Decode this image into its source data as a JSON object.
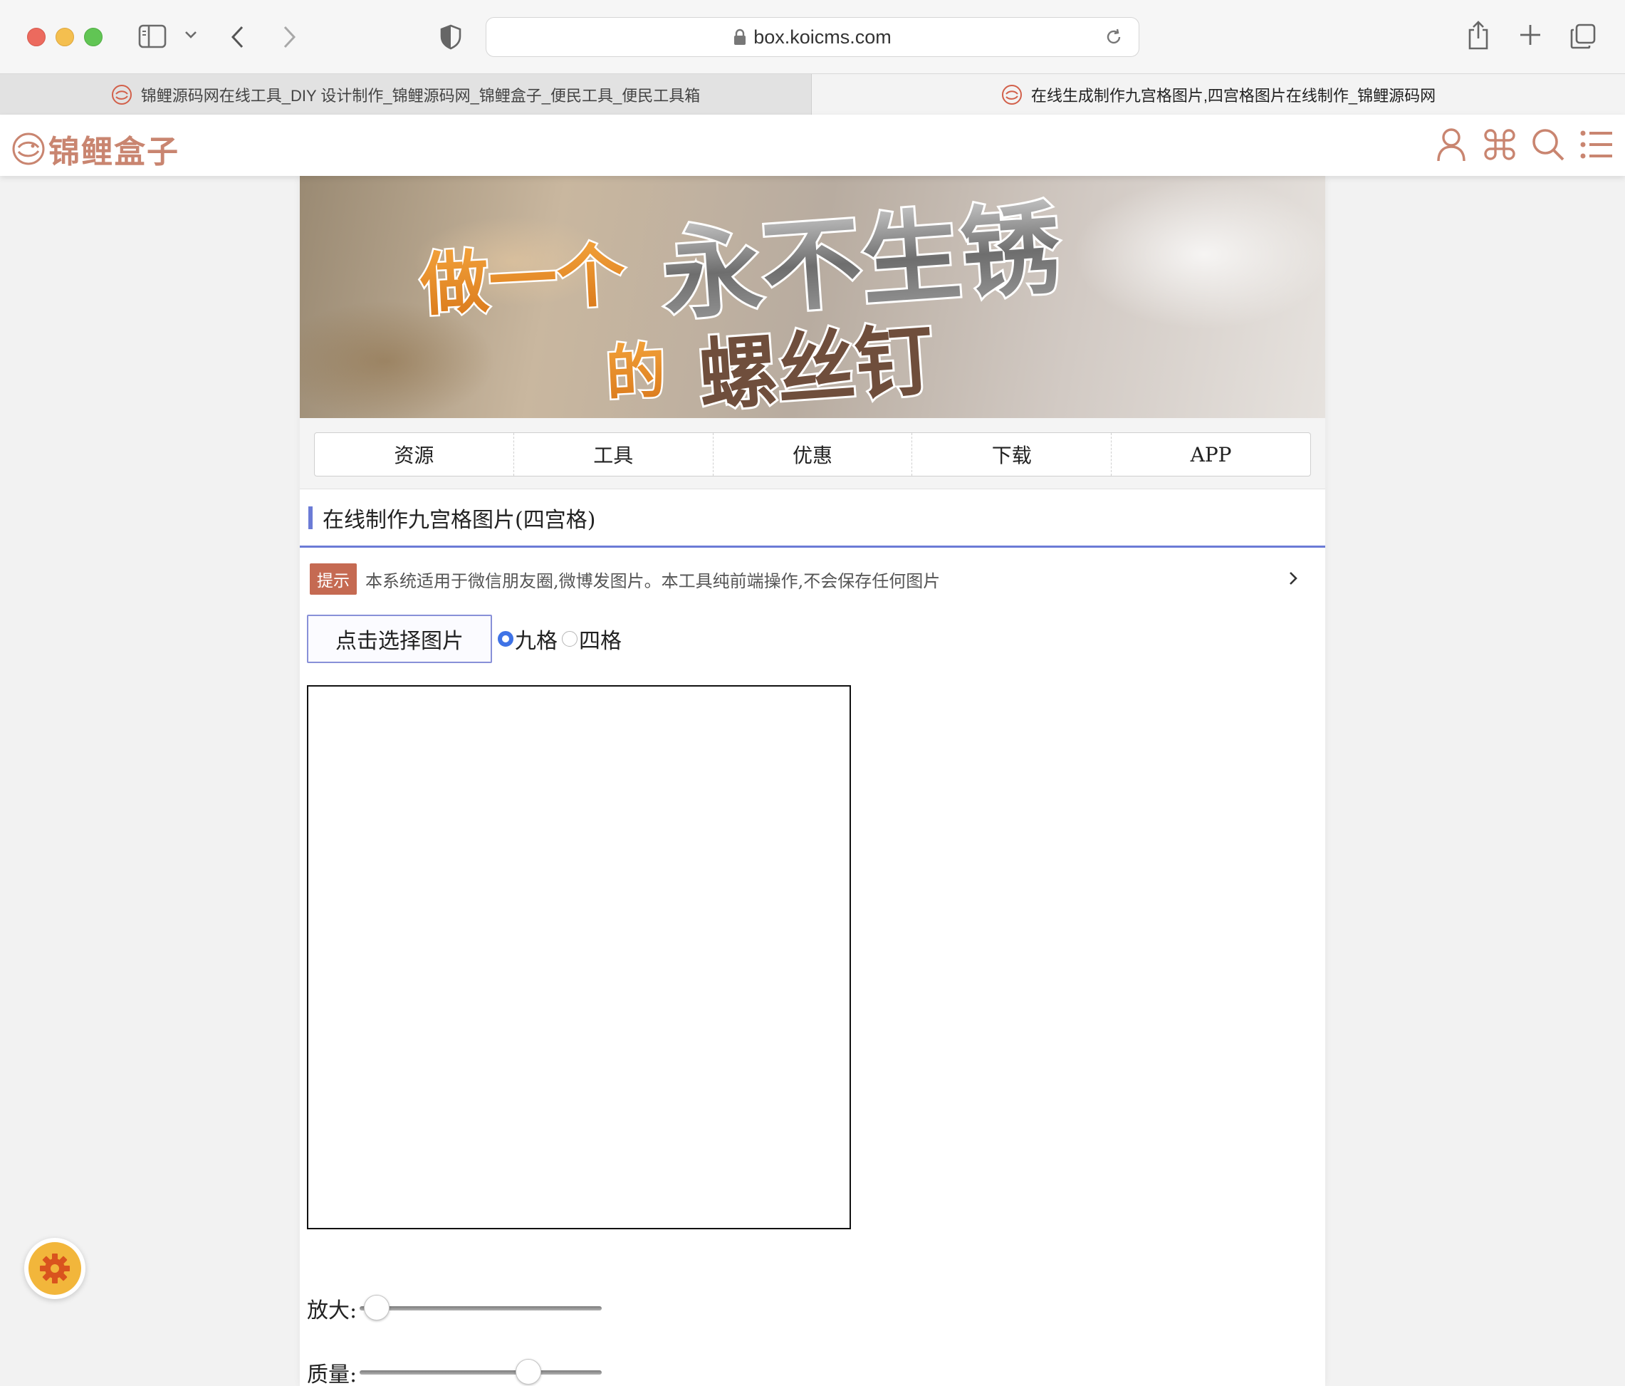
{
  "browser": {
    "url": "box.koicms.com",
    "tabs": [
      {
        "label": "锦鲤源码网在线工具_DIY 设计制作_锦鲤源码网_锦鲤盒子_便民工具_便民工具箱",
        "active": false
      },
      {
        "label": "在线生成制作九宫格图片,四宫格图片在线制作_锦鲤源码网",
        "active": true
      }
    ]
  },
  "site": {
    "logo_text": "锦鲤盒子",
    "brand_color": "#c98570",
    "header_icons": [
      "user-icon",
      "apps-icon",
      "search-icon",
      "menu-list-icon"
    ]
  },
  "banner": {
    "line1_orange": "做一个",
    "line1_steel": "永不生锈",
    "line2_orange": "的",
    "line2_brown": "螺丝钉"
  },
  "nav": {
    "items": [
      "资源",
      "工具",
      "优惠",
      "下载",
      "APP"
    ]
  },
  "section": {
    "title": "在线制作九宫格图片(四宫格)",
    "accent_color": "#6b7bd6"
  },
  "notice": {
    "tag": "提示",
    "text": "本系统适用于微信朋友圈,微博发图片。本工具纯前端操作,不会保存任何图片"
  },
  "tool": {
    "pick_button": "点击选择图片",
    "grid_options": [
      {
        "label": "九格",
        "selected": true
      },
      {
        "label": "四格",
        "selected": false
      }
    ],
    "zoom": {
      "label": "放大:",
      "value_fraction": 0.02
    },
    "quality": {
      "label": "质量:",
      "value_fraction": 0.72
    }
  }
}
